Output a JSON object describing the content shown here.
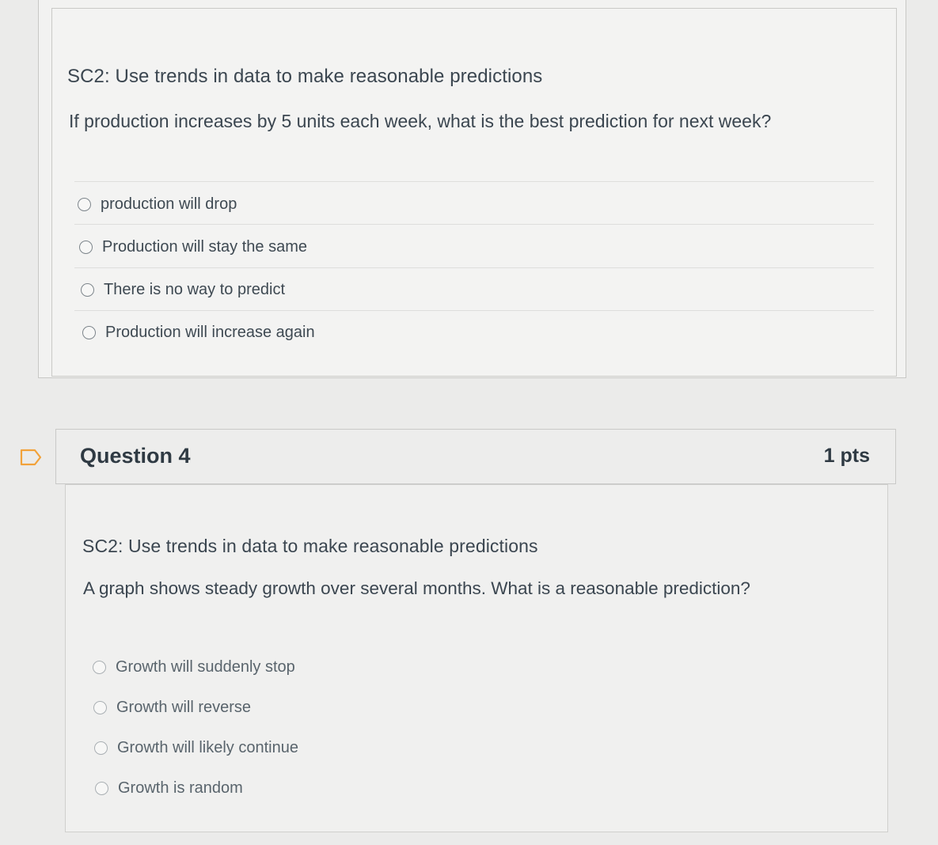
{
  "question3": {
    "standard": "SC2: Use trends in data to make reasonable predictions",
    "prompt": "If production increases by 5 units each week, what is the best prediction for next week?",
    "options": [
      "production will drop",
      "Production will stay the same",
      "There is no way to predict",
      "Production will increase again"
    ]
  },
  "question4": {
    "title": "Question 4",
    "points": "1 pts",
    "standard": "SC2: Use trends in data to make reasonable predictions",
    "prompt": "A graph shows steady growth over several months. What is a reasonable prediction?",
    "options": [
      "Growth will suddenly stop",
      "Growth will reverse",
      "Growth will likely continue",
      "Growth is random"
    ]
  },
  "colors": {
    "accent_flag": "#f2a23a",
    "text": "#2d3b45",
    "background": "#ebebea"
  },
  "icons": {
    "flag": "flag-outline-icon",
    "radio": "radio-button-icon"
  }
}
